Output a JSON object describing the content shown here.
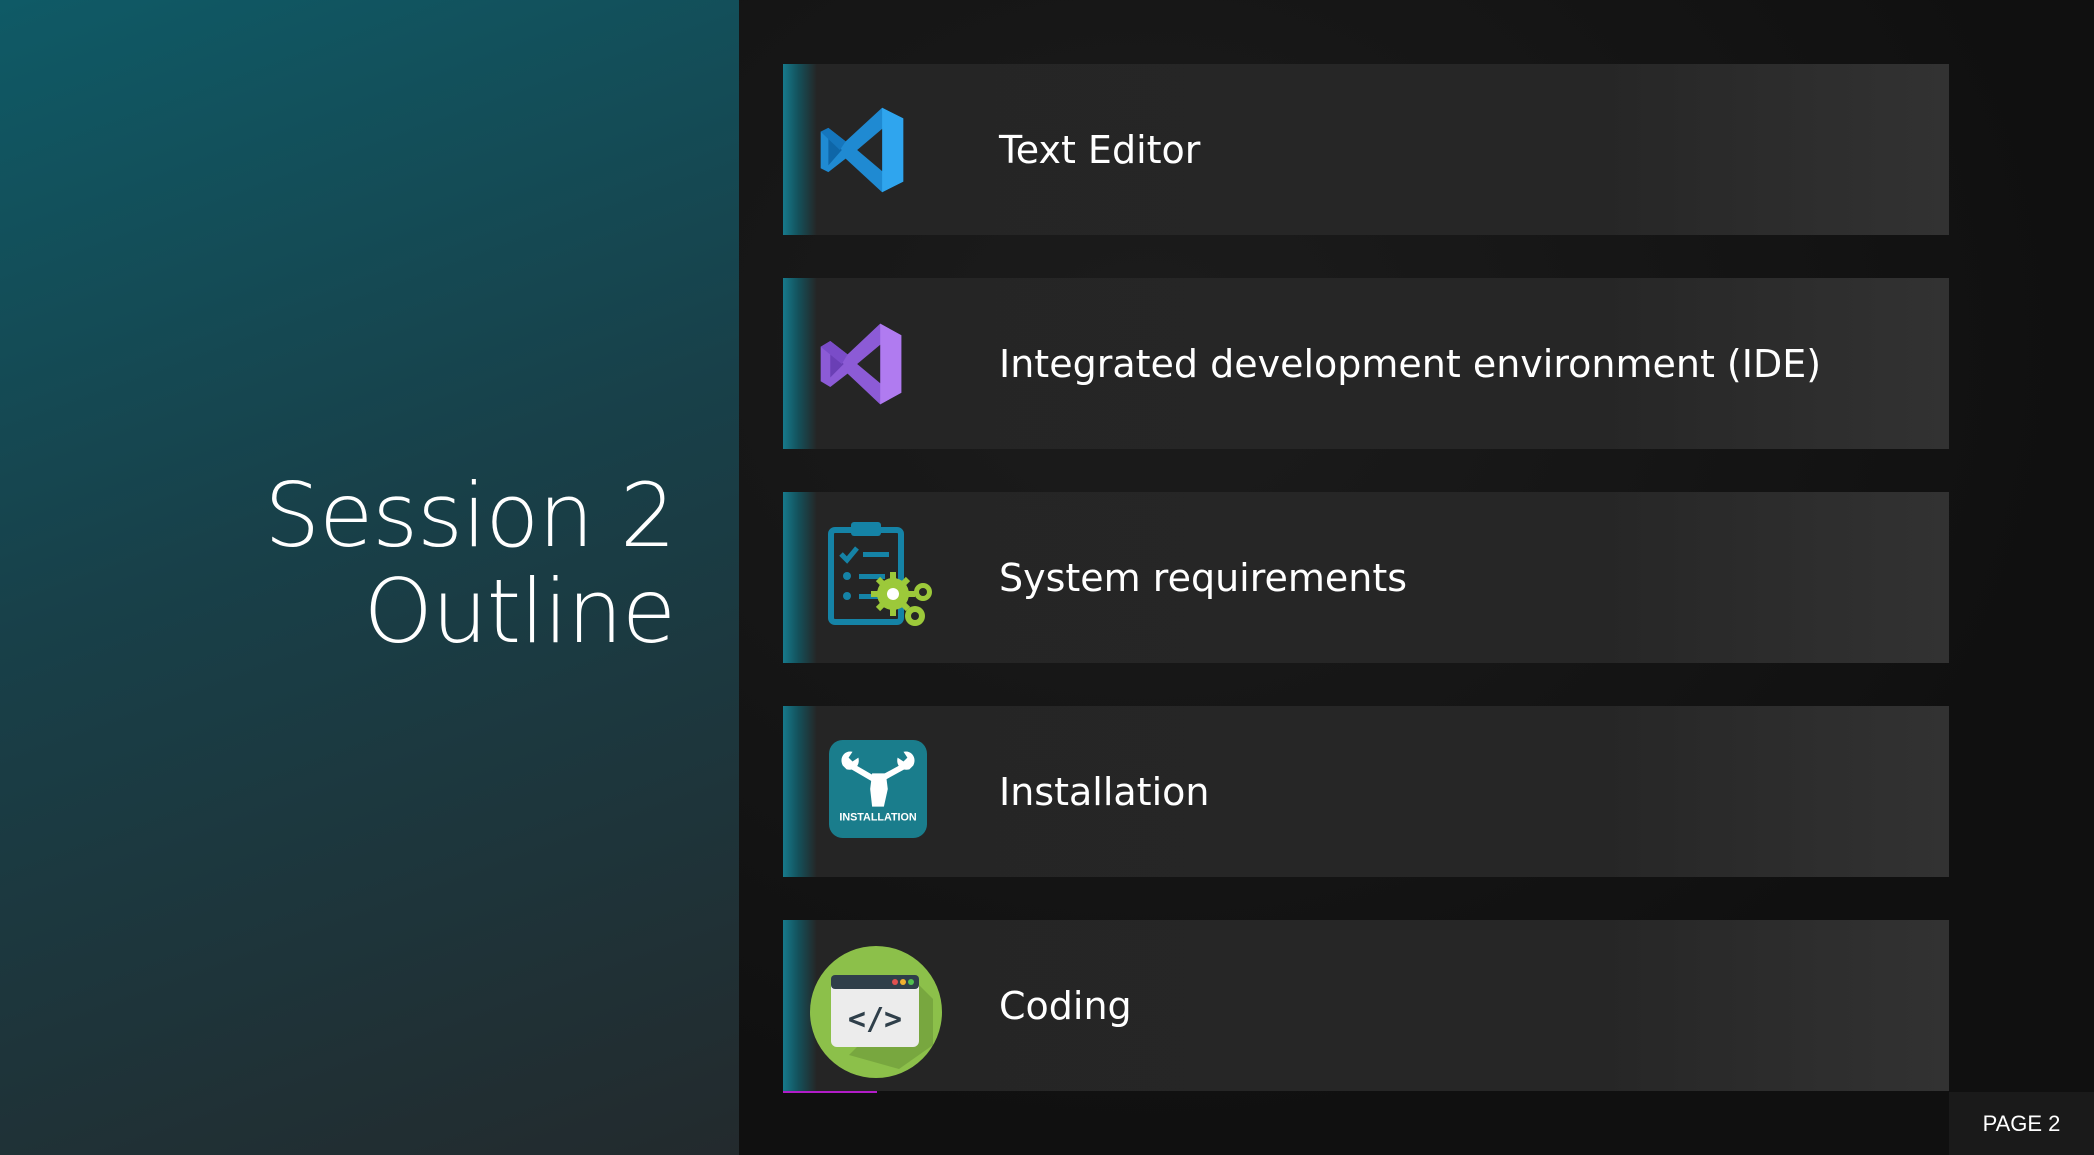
{
  "slide": {
    "title_line1": "Session 2",
    "title_line2": "Outline",
    "page_label": "PAGE 2"
  },
  "outline": {
    "items": [
      {
        "label": "Text Editor",
        "icon": "vscode-icon"
      },
      {
        "label": "Integrated development environment (IDE)",
        "icon": "visual-studio-icon"
      },
      {
        "label": "System requirements",
        "icon": "clipboard-gears-icon"
      },
      {
        "label": "Installation",
        "icon": "installation-wrench-icon",
        "icon_text": "INSTALLATION"
      },
      {
        "label": "Coding",
        "icon": "code-window-icon",
        "icon_text": "</>"
      }
    ]
  },
  "colors": {
    "left_panel_top": "#0f5a66",
    "left_panel_bottom": "#232a2d",
    "item_background": "#262626",
    "accent_teal": "#167a8c",
    "text": "#ffffff"
  }
}
